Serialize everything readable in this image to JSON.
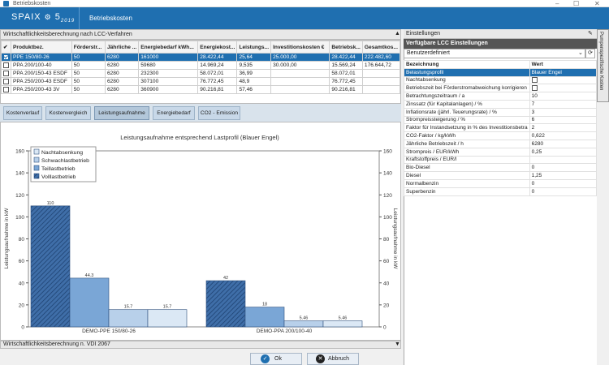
{
  "window": {
    "title": "Betriebskosten",
    "controls": [
      "–",
      "☐",
      "✕"
    ]
  },
  "header": {
    "logo": "SPAIX",
    "logo_version": "5",
    "logo_year": "2019",
    "title": "Betriebskosten"
  },
  "top_panel": {
    "title": "Wirtschaftlichkeitsberechnung nach LCC-Verfahren"
  },
  "table": {
    "columns": [
      "Produktbez.",
      "Förderstr...",
      "Jährliche ...",
      "Energiebedarf kWh...",
      "Energiekost...",
      "Leistungs...",
      "Investitionskosten €",
      "Betriebsk...",
      "Gesamtkos..."
    ],
    "rows": [
      {
        "checked": true,
        "selected": true,
        "cells": [
          "PPE 150/80-26",
          "50",
          "6280",
          "161000",
          "28.422,44",
          "25,64",
          "25.000,00",
          "28.422,44",
          "222.482,60"
        ]
      },
      {
        "checked": false,
        "selected": false,
        "cells": [
          "PPA 200/100-40",
          "50",
          "6280",
          "59680",
          "14.969,24",
          "9,535",
          "30.000,00",
          "15.569,24",
          "176.644,72"
        ]
      },
      {
        "checked": false,
        "selected": false,
        "cells": [
          "PPA 200/150-43 ESDF",
          "50",
          "6280",
          "232300",
          "58.072,01",
          "36,99",
          "",
          "58.072,01",
          ""
        ]
      },
      {
        "checked": false,
        "selected": false,
        "cells": [
          "PPA 250/200-43 ESDF",
          "50",
          "6280",
          "307100",
          "76.772,45",
          "48,9",
          "",
          "76.772,45",
          ""
        ]
      },
      {
        "checked": false,
        "selected": false,
        "cells": [
          "PPA 250/200-43 3V",
          "50",
          "6280",
          "360900",
          "90.216,81",
          "57,46",
          "",
          "90.216,81",
          ""
        ]
      }
    ]
  },
  "tabs": [
    "Kostenverlauf",
    "Kostenvergleich",
    "Leistungsaufnahme",
    "Energiebedarf",
    "CO2 - Emission"
  ],
  "active_tab": "Leistungsaufnahme",
  "chart_data": {
    "type": "bar",
    "title": "Leistungsaufnahme entsprechend Lastprofil (Blauer Engel)",
    "ylabel": "Leistungsaufnahme in kW",
    "ylabel_right": "Leistungsaufnahme in kW",
    "ylim": [
      0,
      160
    ],
    "yticks": [
      0,
      20,
      40,
      60,
      80,
      100,
      120,
      140,
      160
    ],
    "categories": [
      "DEMO-PPE 150/80-26",
      "DEMO-PPA 200/100-40"
    ],
    "series": [
      {
        "name": "Nachtabsenkung",
        "values": [
          null,
          null
        ],
        "color": "#dbe8f5"
      },
      {
        "name": "Schwachlastbetrieb",
        "values": [
          15.7,
          5.46
        ],
        "color": "#b8d0ea"
      },
      {
        "name": "Teillastbetrieb",
        "values": [
          44.3,
          18
        ],
        "color": "#7aa6d6"
      },
      {
        "name": "Volllastbetrieb",
        "values": [
          110,
          42
        ],
        "color": "#3f6ea8"
      }
    ],
    "extra_bars": [
      {
        "value": 15.7,
        "label": "15.7"
      },
      {
        "value": 5.46,
        "label": "5.46"
      }
    ],
    "legend": "top-left"
  },
  "footer_panel": {
    "title": "Wirtschaftlichkeitsberechnung n. VDI 2067"
  },
  "buttons": {
    "ok": "Ok",
    "cancel": "Abbruch"
  },
  "right_panel": {
    "title": "Einstellungen",
    "section": "Verfügbare LCC Einstellungen",
    "preset": "Benutzerdefiniert",
    "col_name": "Bezeichnung",
    "col_value": "Wert",
    "side_tab": "Pumpenspezifische Kosten",
    "rows": [
      {
        "name": "Belastungsprofil",
        "value": "Blauer Engel",
        "selected": true
      },
      {
        "name": "Nachtabsenkung",
        "value": "",
        "checkbox": true
      },
      {
        "name": "Betriebszeit bei Förderstromabweichung korrigieren",
        "value": "",
        "checkbox": true
      },
      {
        "name": "Betrachtungszeitraum / a",
        "value": "10"
      },
      {
        "name": "Zinssatz (für Kapitalanlagen) / %",
        "value": "7"
      },
      {
        "name": "Inflationsrate (jährl. Teuerungsrate) / %",
        "value": "3"
      },
      {
        "name": "Strompreissteigerung / %",
        "value": "6"
      },
      {
        "name": "Faktor für Instandsetzung in % des Investitionsbetra",
        "value": "2"
      },
      {
        "name": "CO2-Faktor / kg/kWh",
        "value": "0,622"
      },
      {
        "name": "Jährliche Betriebszeit / h",
        "value": "6280"
      },
      {
        "name": "Strompreis / EUR/kWh",
        "value": "0,25"
      },
      {
        "name": "Kraftstoffpreis / EUR/l",
        "value": ""
      },
      {
        "name": "Bio-Diesel",
        "value": "0"
      },
      {
        "name": "Diesel",
        "value": "1,25"
      },
      {
        "name": "Normalbenzin",
        "value": "0"
      },
      {
        "name": "Superbenzin",
        "value": "0"
      }
    ]
  }
}
